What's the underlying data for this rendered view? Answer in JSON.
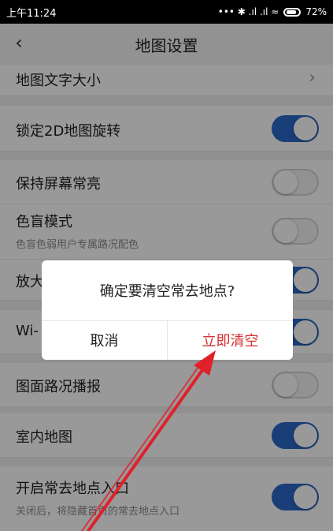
{
  "status_bar": {
    "time": "上午11:24",
    "signal_text": "••• ✱ .ıl .ıl ≈",
    "battery": "72%"
  },
  "header": {
    "title": "地图设置"
  },
  "settings": {
    "text_size": "地图文字大小",
    "lock_2d": "锁定2D地图旋转",
    "keep_screen": "保持屏幕常亮",
    "color_blind": "色盲模式",
    "color_blind_sub": "色盲色弱用户专属路况配色",
    "zoom": "放大",
    "wifi": "Wi-",
    "traffic_report": "图面路况播报",
    "indoor_map": "室内地图",
    "frequent_places": "开启常去地点入口",
    "frequent_places_sub": "关闭后，将隐藏首页的常去地点入口"
  },
  "toggle_states": {
    "lock_2d": true,
    "keep_screen": false,
    "color_blind": false,
    "zoom": true,
    "wifi": true,
    "traffic_report": false,
    "indoor_map": true,
    "frequent_places": true
  },
  "dialog": {
    "message": "确定要清空常去地点?",
    "cancel": "取消",
    "confirm": "立即清空"
  },
  "colors": {
    "accent": "#2a68c8",
    "danger": "#d43030",
    "arrow": "#e0202a"
  }
}
